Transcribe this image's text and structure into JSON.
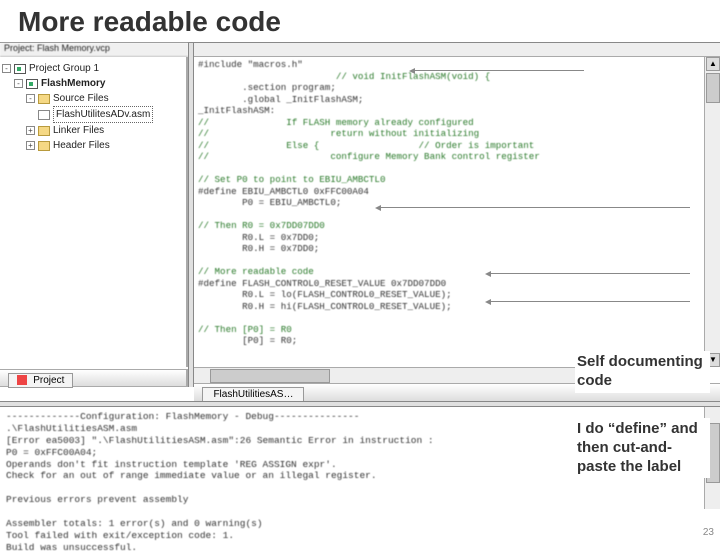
{
  "title": "More readable code",
  "crumb": "Project: Flash Memory.vcp",
  "tree": {
    "root": "Project Group 1",
    "project": "FlashMemory",
    "folders": {
      "source": "Source Files",
      "linker": "Linker Files",
      "header": "Header Files"
    },
    "file": "FlashUtilitesADv.asm"
  },
  "project_tab": "Project",
  "code_tab": "FlashUtilitiesAS…",
  "code_lines": [
    "#include \"macros.h\"",
    "                         // void InitFlashASM(void) {",
    "        .section program;",
    "        .global _InitFlashASM;",
    "_InitFlashASM:",
    "//              If FLASH memory already configured",
    "//                      return without initializing",
    "//              Else {                  // Order is important",
    "//                      configure Memory Bank control register",
    "",
    "// Set P0 to point to EBIU_AMBCTL0",
    "#define EBIU_AMBCTL0 0xFFC00A04",
    "        P0 = EBIU_AMBCTL0;",
    "",
    "// Then R0 = 0x7DD07DD0",
    "        R0.L = 0x7DD0;",
    "        R0.H = 0x7DD0;",
    "",
    "// More readable code",
    "#define FLASH_CONTROL0_RESET_VALUE 0x7DD07DD0",
    "        R0.L = lo(FLASH_CONTROL0_RESET_VALUE);",
    "        R0.H = hi(FLASH_CONTROL0_RESET_VALUE);",
    "",
    "// Then [P0] = R0",
    "        [P0] = R0;"
  ],
  "output_lines": [
    "-------------Configuration: FlashMemory - Debug---------------",
    ".\\FlashUtilitiesASM.asm",
    "[Error ea5003] \".\\FlashUtilitiesASM.asm\":26 Semantic Error in instruction :",
    "P0 = 0xFFC00A04;",
    "Operands don't fit instruction template 'REG ASSIGN expr'.",
    "Check for an out of range immediate value or an illegal register.",
    "",
    "Previous errors prevent assembly",
    "",
    "Assembler totals: 1 error(s) and 0 warning(s)",
    "Tool failed with exit/exception code: 1.",
    "Build was unsuccessful."
  ],
  "callouts": {
    "self_doc": "Self documenting code",
    "define": "I do “define” and then cut-and-paste the label"
  },
  "slide_number": "23"
}
